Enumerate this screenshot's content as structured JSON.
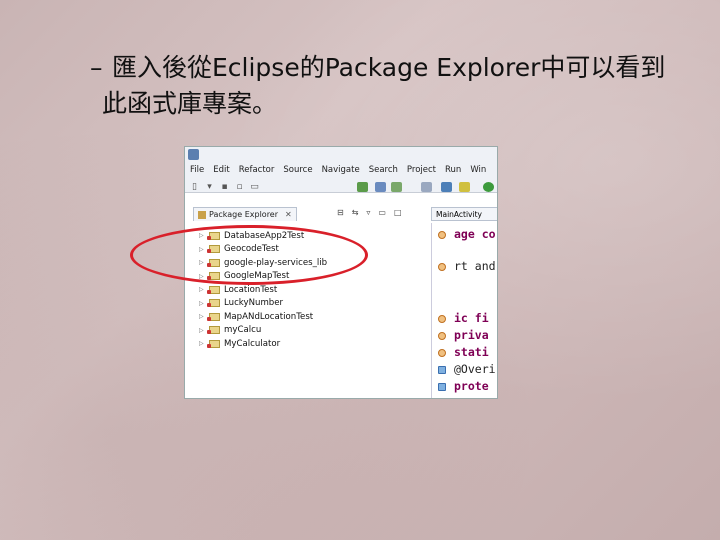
{
  "slide": {
    "bullet_dash": "–",
    "bullet_line1": "匯入後從Eclipse的Package Explorer中可以看到",
    "bullet_line2": "此函式庫專案。"
  },
  "eclipse": {
    "menu": [
      "File",
      "Edit",
      "Refactor",
      "Source",
      "Navigate",
      "Search",
      "Project",
      "Run",
      "Win"
    ],
    "package_explorer_tab": "Package Explorer",
    "tab_close": "✕",
    "projects": [
      "DatabaseApp2Test",
      "GeocodeTest",
      "google-play-services_lib",
      "GoogleMapTest",
      "LocationTest",
      "LuckyNumber",
      "MapANdLocationTest",
      "myCalcu",
      "MyCalculator"
    ],
    "editor_tab": "MainActivity",
    "code_lines": [
      "age co",
      "rt and",
      "ic fi",
      "priva",
      "stati",
      "@Overi",
      "prote"
    ]
  },
  "colors": {
    "highlight": "#d9202a",
    "keyword": "#7f0055"
  }
}
